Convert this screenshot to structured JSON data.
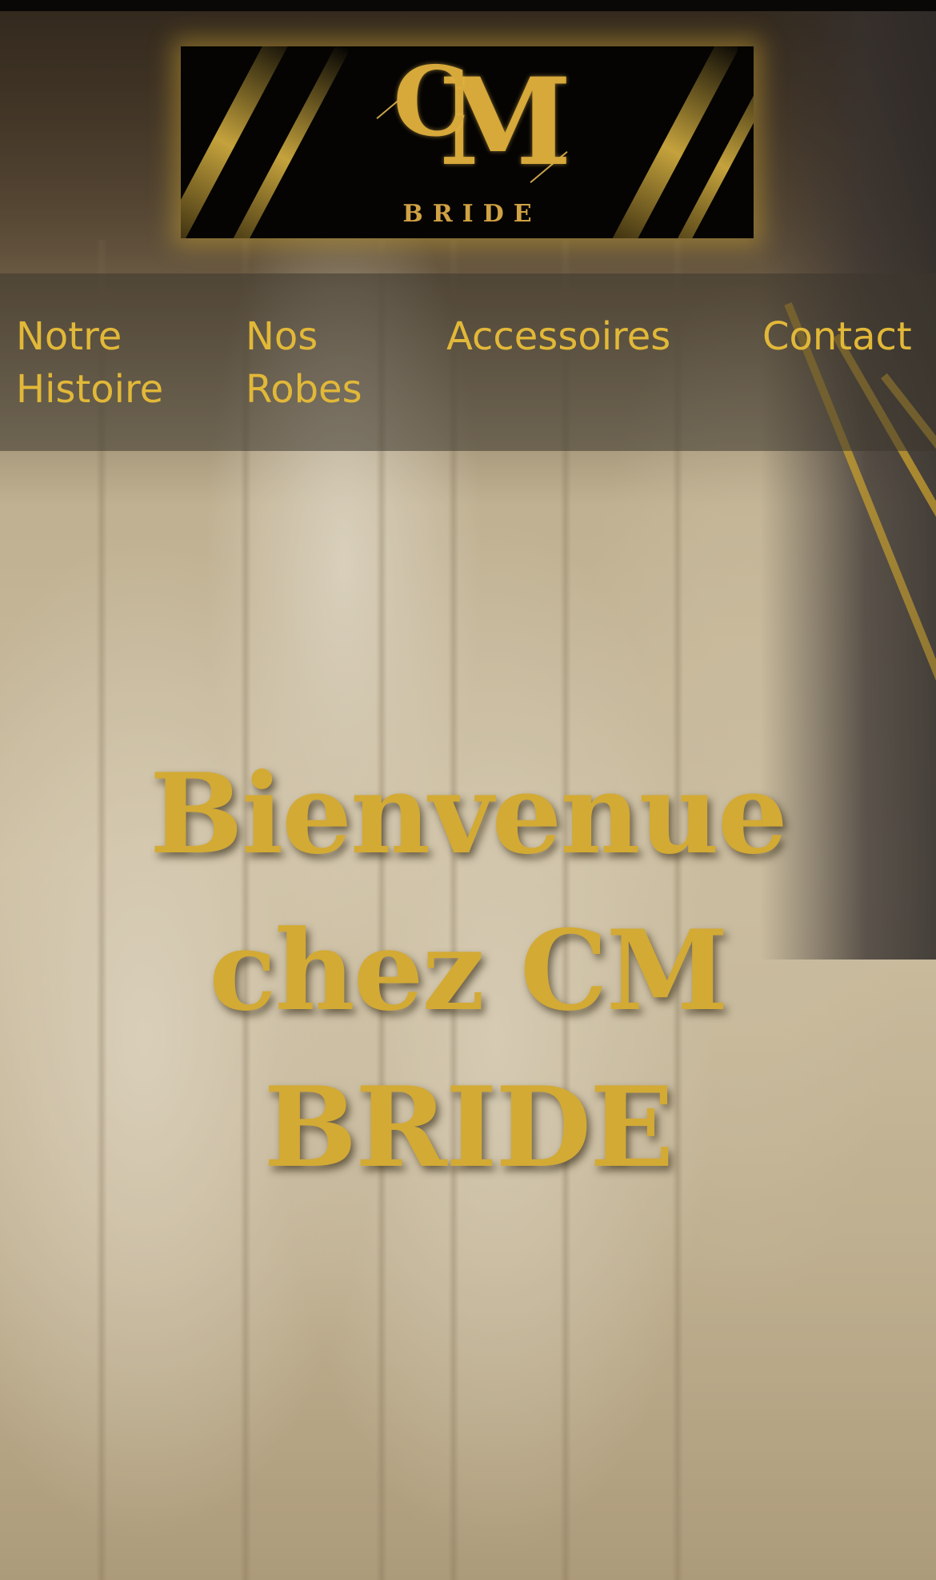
{
  "logo": {
    "monogram_letter_1": "C",
    "monogram_letter_2": "M",
    "brand_text": "BRIDE"
  },
  "nav": {
    "items": [
      {
        "label": "Notre Histoire"
      },
      {
        "label": "Nos Robes"
      },
      {
        "label": "Accessoires"
      },
      {
        "label": "Contact"
      }
    ]
  },
  "hero": {
    "title": "Bienvenue chez CM BRIDE"
  },
  "colors": {
    "accent_gold": "#d3aa34",
    "nav_text": "#e2b838",
    "logo_background": "#050403"
  }
}
